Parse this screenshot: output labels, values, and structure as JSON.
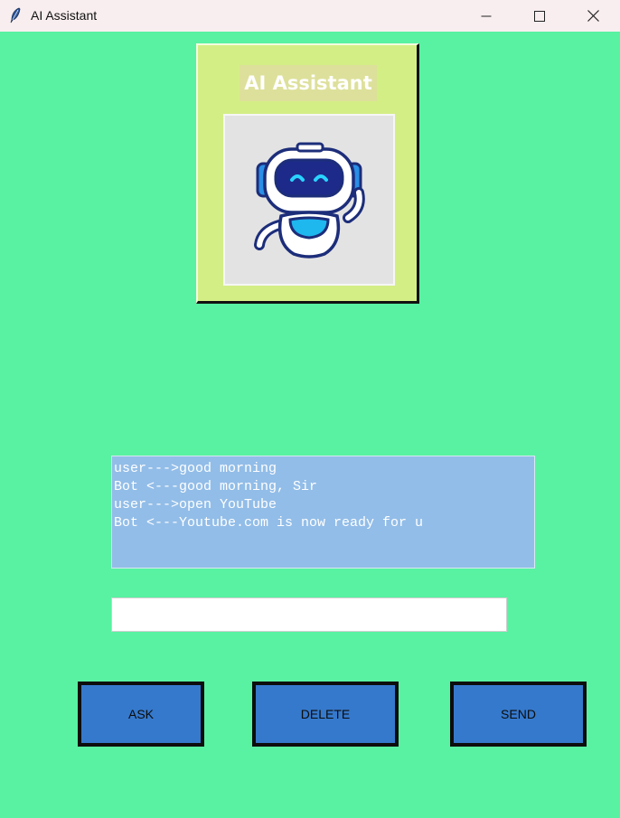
{
  "window": {
    "title": "AI Assistant"
  },
  "header": {
    "title": "AI Assistant",
    "image_icon": "robot-icon"
  },
  "chat": {
    "lines": [
      "user--->good morning",
      "Bot <---good morning, Sir",
      "user--->open YouTube",
      "Bot <---Youtube.com is now ready for u"
    ]
  },
  "input": {
    "value": "",
    "placeholder": ""
  },
  "buttons": {
    "ask_label": "ASK",
    "delete_label": "DELETE",
    "send_label": "SEND"
  },
  "colors": {
    "background": "#58f2a2",
    "header_panel": "#d4ee86",
    "chat_background": "#92bde8",
    "button": "#3579cc"
  }
}
